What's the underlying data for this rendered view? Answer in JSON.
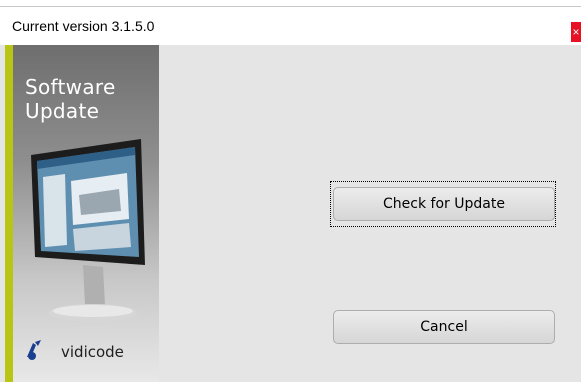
{
  "window": {
    "title": "Current version 3.1.5.0",
    "close_symbol": "×"
  },
  "banner": {
    "title_line1": "Software",
    "title_line2": "Update",
    "brand": "vidicode",
    "accent_color": "#b9c514"
  },
  "buttons": {
    "check_label": "Check for Update",
    "cancel_label": "Cancel"
  },
  "icons": {
    "close": "close-icon",
    "monitor": "monitor-icon",
    "brand_logo": "vidicode-logo-icon"
  },
  "colors": {
    "close_bg": "#e81123",
    "dialog_bg": "#e5e5e5"
  }
}
